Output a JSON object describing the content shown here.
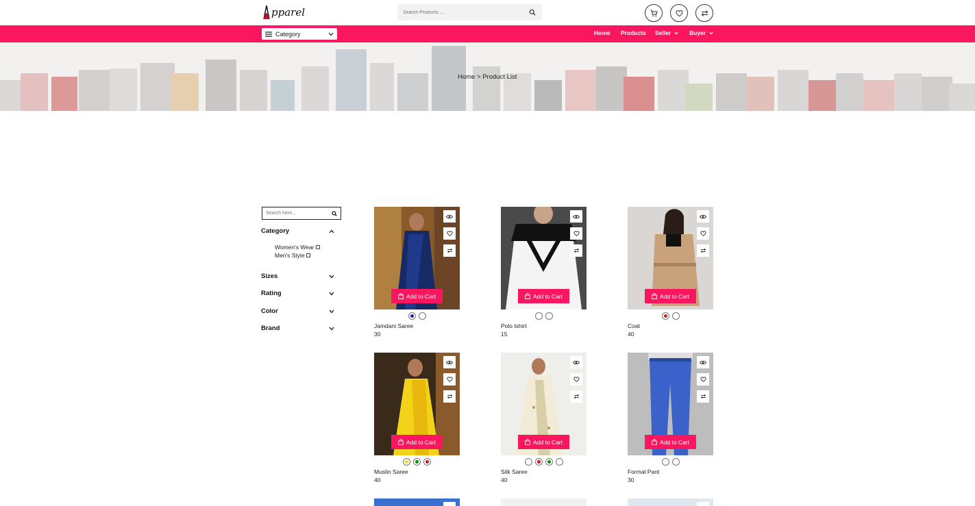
{
  "brand": {
    "logo_text": "pparel"
  },
  "header": {
    "search_placeholder": "Search Products ....",
    "icons": [
      "cart-icon",
      "heart-icon",
      "compare-icon"
    ]
  },
  "nav": {
    "category_label": "Category",
    "links": [
      "Home",
      "Products",
      "Seller",
      "Buyer"
    ]
  },
  "breadcrumb": {
    "home": "Home",
    "sep": ">",
    "current": "Product List"
  },
  "sidebar": {
    "search_placeholder": "Search here...",
    "category_title": "Category",
    "category_options": [
      "Women's Wear",
      "Men's Style"
    ],
    "filters": [
      "Sizes",
      "Rating",
      "Color",
      "Brand"
    ]
  },
  "colors": {
    "accent": "#fb175f"
  },
  "products": [
    {
      "name": "Jamdani Saree",
      "price": "30",
      "swatches": [
        "#1a1ad0",
        "#ffffff"
      ]
    },
    {
      "name": "Polo tshirt",
      "price": "15",
      "swatches": [
        "#ffffff",
        "#ffffff"
      ]
    },
    {
      "name": "Coat",
      "price": "40",
      "swatches": [
        "#d01a1a",
        "#ffffff"
      ]
    },
    {
      "name": "Muslin Saree",
      "price": "40",
      "swatches": [
        "#f0e010",
        "#118811",
        "#d01a1a"
      ]
    },
    {
      "name": "Silk Saree",
      "price": "40",
      "swatches": [
        "#ffffff",
        "#d01a1a",
        "#118811",
        "#ffffff"
      ]
    },
    {
      "name": "Formal Pant",
      "price": "30",
      "swatches": [
        "#ffffff",
        "#ffffff"
      ]
    }
  ],
  "add_to_cart_label": "Add to Cart"
}
